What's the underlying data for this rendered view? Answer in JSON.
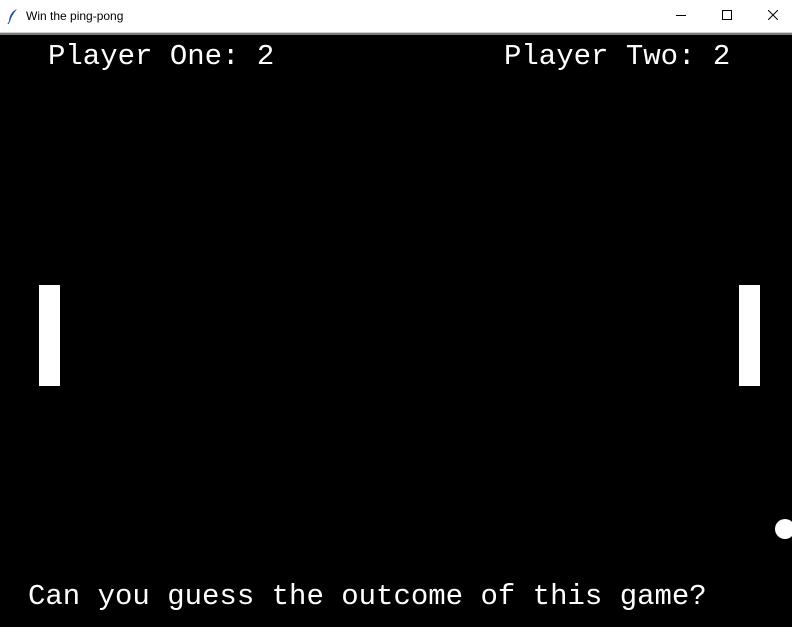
{
  "window": {
    "title": "Win the ping-pong",
    "controls": {
      "minimize_icon": "minimize-icon",
      "maximize_icon": "maximize-icon",
      "close_icon": "close-icon"
    }
  },
  "game": {
    "background_color": "#000000",
    "foreground_color": "#ffffff",
    "score": {
      "player_one_text": "Player One: 2",
      "player_two_text": "Player Two: 2",
      "player_one": 2,
      "player_two": 2
    },
    "message": "Can you guess the outcome of this game?"
  }
}
